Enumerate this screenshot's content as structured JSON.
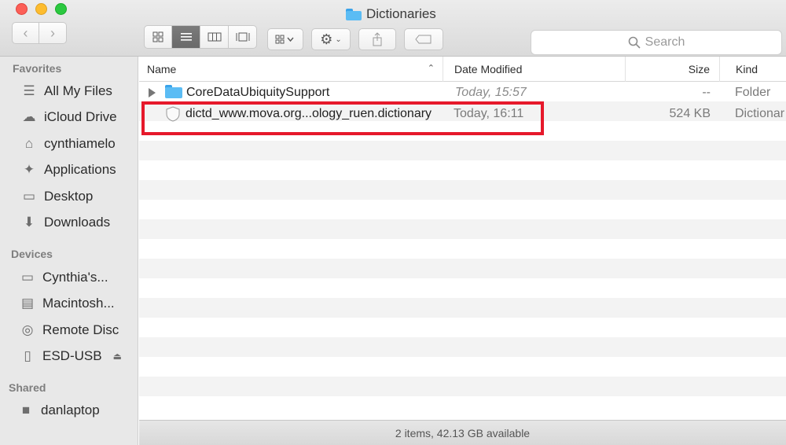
{
  "window": {
    "title": "Dictionaries"
  },
  "toolbar": {
    "search_placeholder": "Search",
    "icons": {
      "back": "chevron-left-icon",
      "forward": "chevron-right-icon",
      "icon_view": "icon-grid-icon",
      "list_view": "list-icon",
      "column_view": "columns-icon",
      "gallery_view": "gallery-icon",
      "arrange": "arrange-icon",
      "action": "gear-icon",
      "share": "share-icon",
      "tags": "tag-icon",
      "search": "search-icon"
    }
  },
  "sidebar": {
    "favorites_label": "Favorites",
    "favorites": [
      {
        "label": "All My Files",
        "icon": "all-files-icon"
      },
      {
        "label": "iCloud Drive",
        "icon": "cloud-icon"
      },
      {
        "label": "cynthiamelo",
        "icon": "home-icon"
      },
      {
        "label": "Applications",
        "icon": "applications-icon"
      },
      {
        "label": "Desktop",
        "icon": "desktop-icon"
      },
      {
        "label": "Downloads",
        "icon": "download-icon"
      }
    ],
    "devices_label": "Devices",
    "devices": [
      {
        "label": "Cynthia's...",
        "icon": "laptop-icon"
      },
      {
        "label": "Macintosh...",
        "icon": "hard-drive-icon"
      },
      {
        "label": "Remote Disc",
        "icon": "disc-icon"
      },
      {
        "label": "ESD-USB",
        "icon": "usb-drive-icon"
      }
    ],
    "shared_label": "Shared",
    "shared": [
      {
        "label": "danlaptop",
        "icon": "computer-icon"
      }
    ]
  },
  "columns": {
    "name": "Name",
    "date": "Date Modified",
    "size": "Size",
    "kind": "Kind"
  },
  "files": [
    {
      "name": "CoreDataUbiquitySupport",
      "date": "Today, 15:57",
      "size": "--",
      "kind": "Folder"
    },
    {
      "name": "dictd_www.mova.org...ology_ruen.dictionary",
      "date": "Today, 16:11",
      "size": "524 KB",
      "kind": "Dictionar"
    }
  ],
  "status": {
    "text": "2 items, 42.13 GB available"
  },
  "colors": {
    "highlight": "#e6192b",
    "folder": "#5bbcf4"
  }
}
